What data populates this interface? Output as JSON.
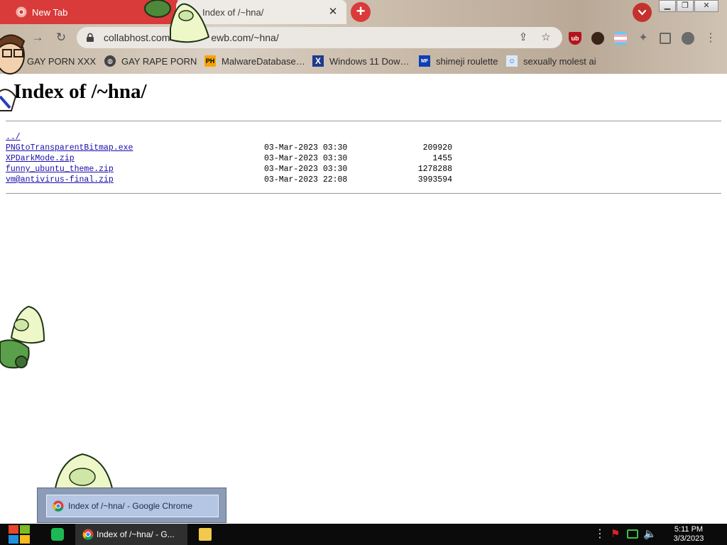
{
  "tabs": [
    {
      "label": "New Tab",
      "active": false
    },
    {
      "label": "Index of /~hna/",
      "active": true
    }
  ],
  "toolbar": {
    "url": "collabhost.com/~ewb.com/~hna/",
    "url_visible_a": "collabhost.com",
    "url_visible_b": "ewb.com/~hna/"
  },
  "bookmarks": [
    {
      "label": "GAY PORN XXX",
      "icon": "page-icon"
    },
    {
      "label": "GAY RAPE PORN",
      "icon": "globe-icon"
    },
    {
      "label": "MalwareDatabase…",
      "icon": "ph-icon"
    },
    {
      "label": "Windows 11 Dow…",
      "icon": "x-icon"
    },
    {
      "label": "shimeji roulette",
      "icon": "mf-icon"
    },
    {
      "label": "sexually molest ai",
      "icon": "bot-icon"
    }
  ],
  "page": {
    "title": "Index of /~hna/",
    "parent_link": "../",
    "files": [
      {
        "name": "PNGtoTransparentBitmap.exe",
        "date": "03-Mar-2023 03:30",
        "size": "209920"
      },
      {
        "name": "XPDarkMode.zip",
        "date": "03-Mar-2023 03:30",
        "size": "1455"
      },
      {
        "name": "funny_ubuntu_theme.zip",
        "date": "03-Mar-2023 03:30",
        "size": "1278288"
      },
      {
        "name": "vm@antivirus-final.zip",
        "date": "03-Mar-2023 22:08",
        "size": "3993594"
      }
    ]
  },
  "switcher": {
    "label": "Index of /~hna/ - Google Chrome"
  },
  "taskbar": {
    "chrome_label": "Index of /~hna/ - G...",
    "time": "5:11 PM",
    "date": "3/3/2023"
  },
  "colors": {
    "tab_red": "#d93a3a",
    "link_blue": "#1a0dab",
    "taskbar": "#0b0b0b"
  }
}
